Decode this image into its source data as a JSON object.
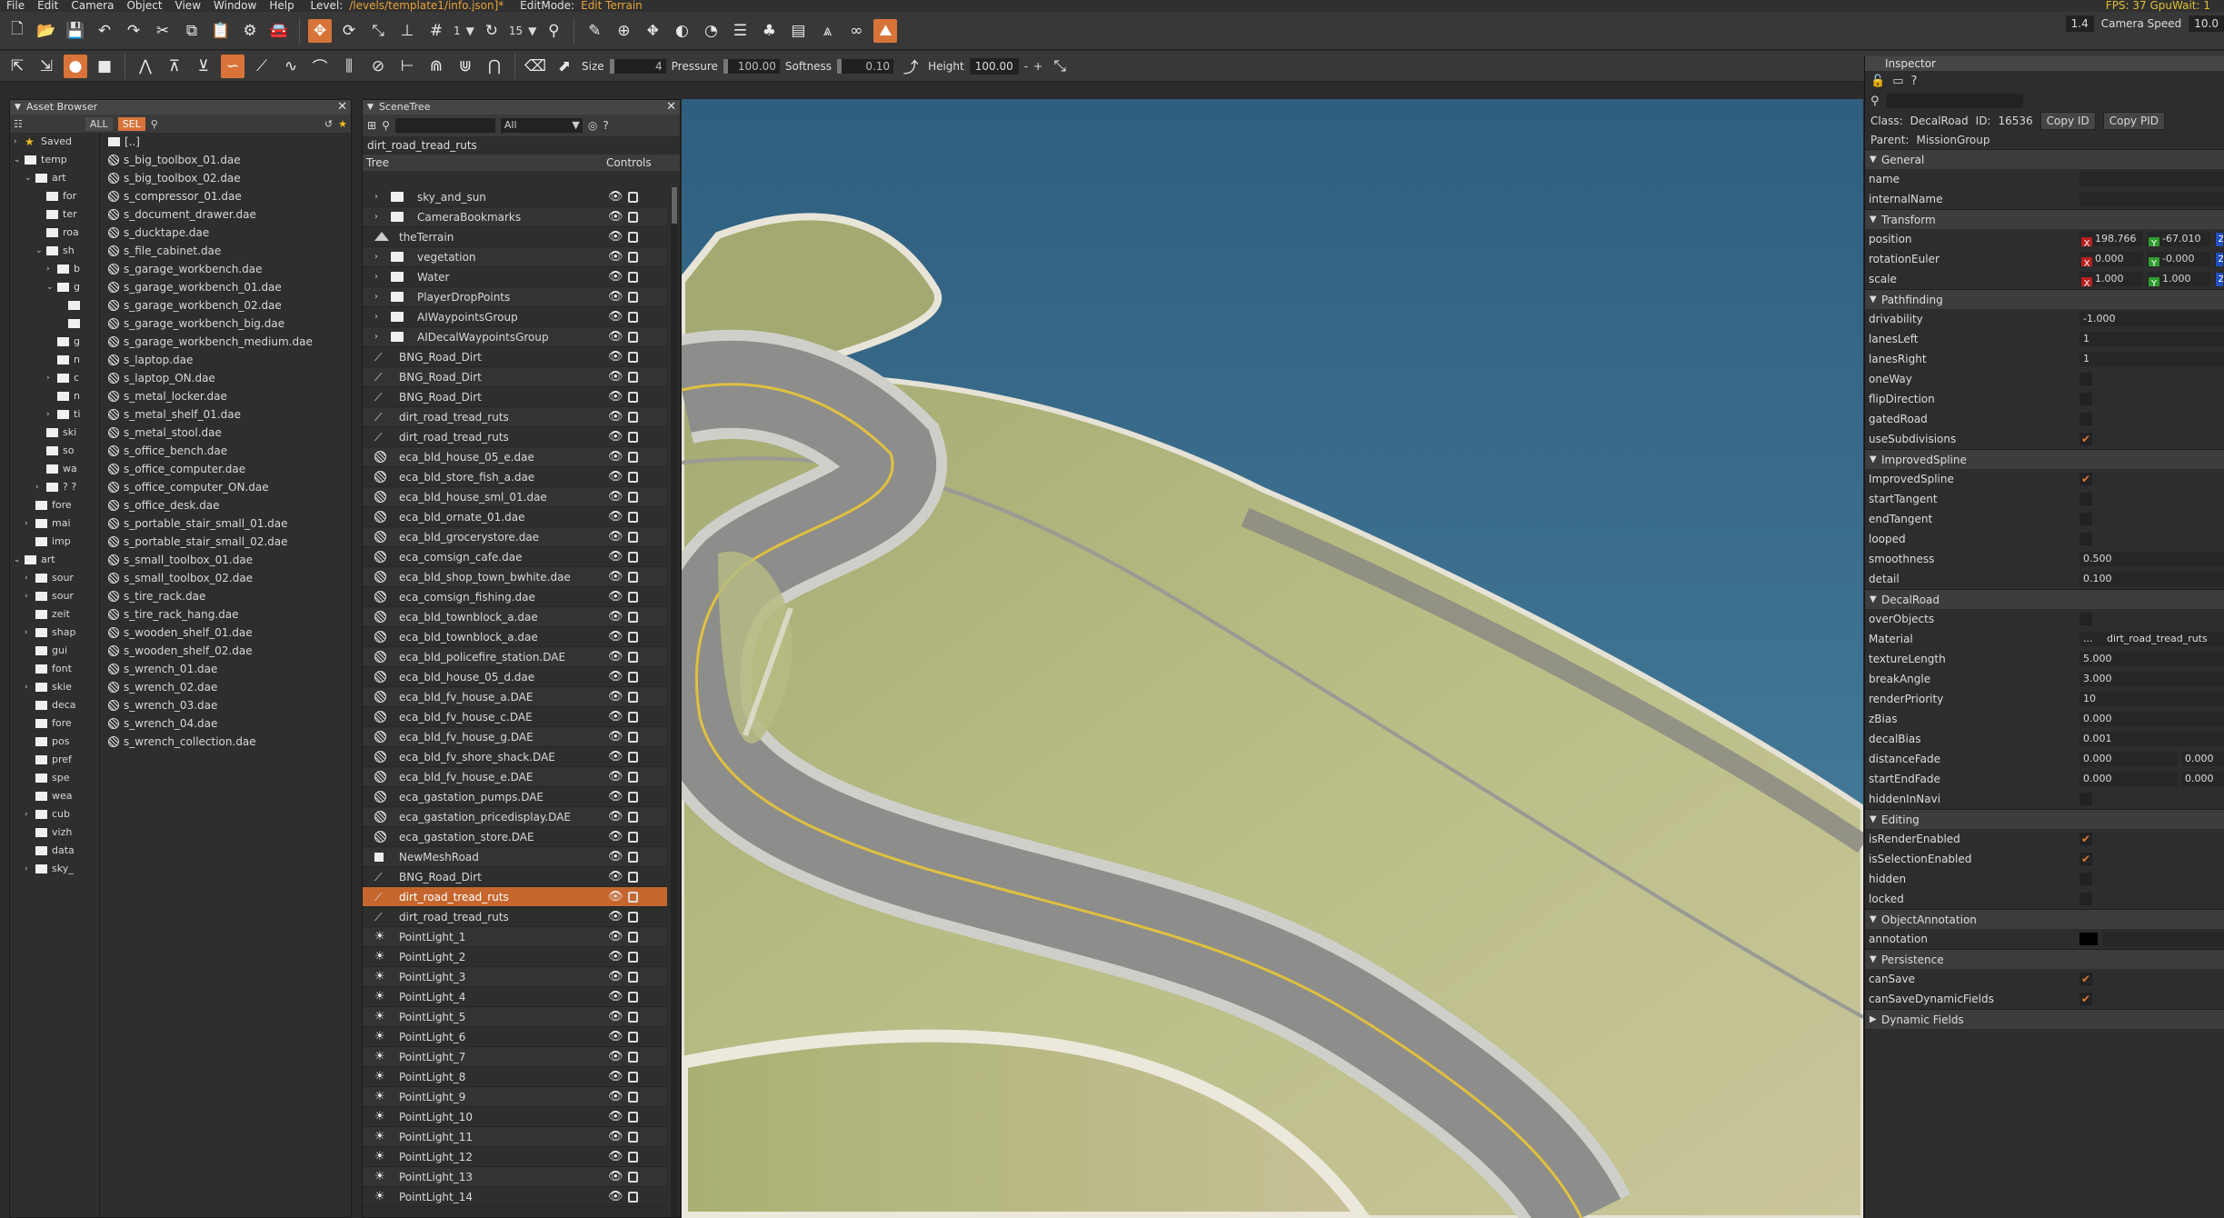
{
  "menu": {
    "items": [
      "File",
      "Edit",
      "Camera",
      "Object",
      "View",
      "Window",
      "Help"
    ],
    "level_label": "Level:",
    "level_path": "/levels/template1/info.json]*",
    "editmode_label": "EditMode:",
    "editmode_value": "Edit Terrain",
    "fps": "FPS: 37  GpuWait: 1"
  },
  "toolbar1": {
    "grid_value": "1",
    "rot_snap_value": "15",
    "right_value1": "1.4",
    "camera_speed_label": "Camera Speed",
    "camera_speed_value": "10.0"
  },
  "toolbar2": {
    "size_label": "Size",
    "size_value": "4",
    "pressure_label": "Pressure",
    "pressure_value": "100.00",
    "softness_label": "Softness",
    "softness_value": "0.10",
    "height_label": "Height",
    "height_value": "100.00",
    "minus": "-",
    "plus": "+"
  },
  "asset_browser": {
    "title": "Asset Browser",
    "all_label": "ALL",
    "sel_label": "SEL",
    "tree": [
      {
        "label": "Saved",
        "indent": 0,
        "arrow": "›",
        "star": true
      },
      {
        "label": "temp",
        "indent": 0,
        "arrow": "⌄"
      },
      {
        "label": "art",
        "indent": 1,
        "arrow": "⌄"
      },
      {
        "label": "for",
        "indent": 2,
        "arrow": ""
      },
      {
        "label": "ter",
        "indent": 2,
        "arrow": ""
      },
      {
        "label": "roa",
        "indent": 2,
        "arrow": ""
      },
      {
        "label": "sh",
        "indent": 2,
        "arrow": "⌄"
      },
      {
        "label": "b",
        "indent": 3,
        "arrow": "›"
      },
      {
        "label": "g",
        "indent": 3,
        "arrow": "⌄"
      },
      {
        "label": "",
        "indent": 4,
        "arrow": ""
      },
      {
        "label": "",
        "indent": 4,
        "arrow": ""
      },
      {
        "label": "g",
        "indent": 3,
        "arrow": ""
      },
      {
        "label": "n",
        "indent": 3,
        "arrow": ""
      },
      {
        "label": "c",
        "indent": 3,
        "arrow": "›"
      },
      {
        "label": "n",
        "indent": 3,
        "arrow": ""
      },
      {
        "label": "ti",
        "indent": 3,
        "arrow": "›"
      },
      {
        "label": "ski",
        "indent": 2,
        "arrow": ""
      },
      {
        "label": "so",
        "indent": 2,
        "arrow": ""
      },
      {
        "label": "wa",
        "indent": 2,
        "arrow": ""
      },
      {
        "label": "? ?",
        "indent": 2,
        "arrow": "›"
      },
      {
        "label": "fore",
        "indent": 1,
        "arrow": ""
      },
      {
        "label": "mai",
        "indent": 1,
        "arrow": "›"
      },
      {
        "label": "imp",
        "indent": 1,
        "arrow": ""
      },
      {
        "label": "art",
        "indent": 0,
        "arrow": "⌄"
      },
      {
        "label": "sour",
        "indent": 1,
        "arrow": "›"
      },
      {
        "label": "sour",
        "indent": 1,
        "arrow": "›"
      },
      {
        "label": "zeit",
        "indent": 1,
        "arrow": ""
      },
      {
        "label": "shap",
        "indent": 1,
        "arrow": "›"
      },
      {
        "label": "gui",
        "indent": 1,
        "arrow": ""
      },
      {
        "label": "font",
        "indent": 1,
        "arrow": ""
      },
      {
        "label": "skie",
        "indent": 1,
        "arrow": "›"
      },
      {
        "label": "deca",
        "indent": 1,
        "arrow": ""
      },
      {
        "label": "fore",
        "indent": 1,
        "arrow": ""
      },
      {
        "label": "pos",
        "indent": 1,
        "arrow": ""
      },
      {
        "label": "pref",
        "indent": 1,
        "arrow": ""
      },
      {
        "label": "spe",
        "indent": 1,
        "arrow": ""
      },
      {
        "label": "wea",
        "indent": 1,
        "arrow": ""
      },
      {
        "label": "cub",
        "indent": 1,
        "arrow": "›"
      },
      {
        "label": "vizh",
        "indent": 1,
        "arrow": ""
      },
      {
        "label": "data",
        "indent": 1,
        "arrow": ""
      },
      {
        "label": "sky_",
        "indent": 1,
        "arrow": "›"
      }
    ],
    "files": [
      "[..]",
      "s_big_toolbox_01.dae",
      "s_big_toolbox_02.dae",
      "s_compressor_01.dae",
      "s_document_drawer.dae",
      "s_ducktape.dae",
      "s_file_cabinet.dae",
      "s_garage_workbench.dae",
      "s_garage_workbench_01.dae",
      "s_garage_workbench_02.dae",
      "s_garage_workbench_big.dae",
      "s_garage_workbench_medium.dae",
      "s_laptop.dae",
      "s_laptop_ON.dae",
      "s_metal_locker.dae",
      "s_metal_shelf_01.dae",
      "s_metal_stool.dae",
      "s_office_bench.dae",
      "s_office_computer.dae",
      "s_office_computer_ON.dae",
      "s_office_desk.dae",
      "s_portable_stair_small_01.dae",
      "s_portable_stair_small_02.dae",
      "s_small_toolbox_01.dae",
      "s_small_toolbox_02.dae",
      "s_tire_rack.dae",
      "s_tire_rack_hang.dae",
      "s_wooden_shelf_01.dae",
      "s_wooden_shelf_02.dae",
      "s_wrench_01.dae",
      "s_wrench_02.dae",
      "s_wrench_03.dae",
      "s_wrench_04.dae",
      "s_wrench_collection.dae"
    ]
  },
  "scene_tree": {
    "title": "SceneTree",
    "filter_value": "All",
    "path": "dirt_road_tread_ruts",
    "col_tree": "Tree",
    "col_controls": "Controls",
    "rows": [
      {
        "label": "sky_and_sun",
        "icon": "folder",
        "expand": true
      },
      {
        "label": "CameraBookmarks",
        "icon": "folder",
        "expand": true
      },
      {
        "label": "theTerrain",
        "icon": "terrain",
        "expand": false
      },
      {
        "label": "vegetation",
        "icon": "folder",
        "expand": true
      },
      {
        "label": "Water",
        "icon": "folder",
        "expand": true
      },
      {
        "label": "PlayerDropPoints",
        "icon": "folder",
        "expand": true
      },
      {
        "label": "AIWaypointsGroup",
        "icon": "folder",
        "expand": true
      },
      {
        "label": "AIDecalWaypointsGroup",
        "icon": "folder",
        "expand": true
      },
      {
        "label": "BNG_Road_Dirt",
        "icon": "road"
      },
      {
        "label": "BNG_Road_Dirt",
        "icon": "road"
      },
      {
        "label": "BNG_Road_Dirt",
        "icon": "road"
      },
      {
        "label": "dirt_road_tread_ruts",
        "icon": "road"
      },
      {
        "label": "dirt_road_tread_ruts",
        "icon": "road"
      },
      {
        "label": "eca_bld_house_05_e.dae",
        "icon": "mesh"
      },
      {
        "label": "eca_bld_store_fish_a.dae",
        "icon": "mesh"
      },
      {
        "label": "eca_bld_house_sml_01.dae",
        "icon": "mesh"
      },
      {
        "label": "eca_bld_ornate_01.dae",
        "icon": "mesh"
      },
      {
        "label": "eca_bld_grocerystore.dae",
        "icon": "mesh"
      },
      {
        "label": "eca_comsign_cafe.dae",
        "icon": "mesh"
      },
      {
        "label": "eca_bld_shop_town_bwhite.dae",
        "icon": "mesh"
      },
      {
        "label": "eca_comsign_fishing.dae",
        "icon": "mesh"
      },
      {
        "label": "eca_bld_townblock_a.dae",
        "icon": "mesh"
      },
      {
        "label": "eca_bld_townblock_a.dae",
        "icon": "mesh"
      },
      {
        "label": "eca_bld_policefire_station.DAE",
        "icon": "mesh"
      },
      {
        "label": "eca_bld_house_05_d.dae",
        "icon": "mesh"
      },
      {
        "label": "eca_bld_fv_house_a.DAE",
        "icon": "mesh"
      },
      {
        "label": "eca_bld_fv_house_c.DAE",
        "icon": "mesh"
      },
      {
        "label": "eca_bld_fv_house_g.DAE",
        "icon": "mesh"
      },
      {
        "label": "eca_bld_fv_shore_shack.DAE",
        "icon": "mesh"
      },
      {
        "label": "eca_bld_fv_house_e.DAE",
        "icon": "mesh"
      },
      {
        "label": "eca_gastation_pumps.DAE",
        "icon": "mesh"
      },
      {
        "label": "eca_gastation_pricedisplay.DAE",
        "icon": "mesh"
      },
      {
        "label": "eca_gastation_store.DAE",
        "icon": "mesh"
      },
      {
        "label": "NewMeshRoad",
        "icon": "box"
      },
      {
        "label": "BNG_Road_Dirt",
        "icon": "road"
      },
      {
        "label": "dirt_road_tread_ruts",
        "icon": "road",
        "selected": true
      },
      {
        "label": "dirt_road_tread_ruts",
        "icon": "road"
      },
      {
        "label": "PointLight_1",
        "icon": "light"
      },
      {
        "label": "PointLight_2",
        "icon": "light"
      },
      {
        "label": "PointLight_3",
        "icon": "light"
      },
      {
        "label": "PointLight_4",
        "icon": "light"
      },
      {
        "label": "PointLight_5",
        "icon": "light"
      },
      {
        "label": "PointLight_6",
        "icon": "light"
      },
      {
        "label": "PointLight_7",
        "icon": "light"
      },
      {
        "label": "PointLight_8",
        "icon": "light"
      },
      {
        "label": "PointLight_9",
        "icon": "light"
      },
      {
        "label": "PointLight_10",
        "icon": "light"
      },
      {
        "label": "PointLight_11",
        "icon": "light"
      },
      {
        "label": "PointLight_12",
        "icon": "light"
      },
      {
        "label": "PointLight_13",
        "icon": "light"
      },
      {
        "label": "PointLight_14",
        "icon": "light"
      }
    ]
  },
  "inspector": {
    "title": "Inspector",
    "class_label": "Class:",
    "class_value": "DecalRoad",
    "id_label": "ID:",
    "id_value": "16536",
    "copy_id": "Copy ID",
    "copy_pid": "Copy PID",
    "parent_label": "Parent:",
    "parent_value": "MissionGroup",
    "rows": [
      {
        "type": "section",
        "label": "General"
      },
      {
        "type": "text",
        "label": "name",
        "value": ""
      },
      {
        "type": "text",
        "label": "internalName",
        "value": ""
      },
      {
        "type": "section",
        "label": "Transform"
      },
      {
        "type": "vec",
        "label": "position",
        "x": "198.766",
        "y": "-67.010"
      },
      {
        "type": "vec",
        "label": "rotationEuler",
        "x": "0.000",
        "y": "-0.000"
      },
      {
        "type": "vec",
        "label": "scale",
        "x": "1.000",
        "y": "1.000"
      },
      {
        "type": "section",
        "label": "Pathfinding"
      },
      {
        "type": "text",
        "label": "drivability",
        "value": "-1.000"
      },
      {
        "type": "text",
        "label": "lanesLeft",
        "value": "1"
      },
      {
        "type": "text",
        "label": "lanesRight",
        "value": "1"
      },
      {
        "type": "check",
        "label": "oneWay",
        "checked": false
      },
      {
        "type": "check",
        "label": "flipDirection",
        "checked": false
      },
      {
        "type": "check",
        "label": "gatedRoad",
        "checked": false
      },
      {
        "type": "check",
        "label": "useSubdivisions",
        "checked": true
      },
      {
        "type": "section",
        "label": "ImprovedSpline"
      },
      {
        "type": "check",
        "label": "ImprovedSpline",
        "checked": true
      },
      {
        "type": "check",
        "label": "startTangent",
        "checked": false
      },
      {
        "type": "check",
        "label": "endTangent",
        "checked": false
      },
      {
        "type": "check",
        "label": "looped",
        "checked": false
      },
      {
        "type": "text",
        "label": "smoothness",
        "value": "0.500"
      },
      {
        "type": "text",
        "label": "detail",
        "value": "0.100"
      },
      {
        "type": "section",
        "label": "DecalRoad"
      },
      {
        "type": "check",
        "label": "overObjects",
        "checked": false
      },
      {
        "type": "material",
        "label": "Material",
        "value": "dirt_road_tread_ruts",
        "btn": "..."
      },
      {
        "type": "text",
        "label": "textureLength",
        "value": "5.000"
      },
      {
        "type": "text",
        "label": "breakAngle",
        "value": "3.000"
      },
      {
        "type": "text",
        "label": "renderPriority",
        "value": "10"
      },
      {
        "type": "text",
        "label": "zBias",
        "value": "0.000"
      },
      {
        "type": "text",
        "label": "decalBias",
        "value": "0.001"
      },
      {
        "type": "pair",
        "label": "distanceFade",
        "a": "0.000",
        "b": "0.000"
      },
      {
        "type": "pair",
        "label": "startEndFade",
        "a": "0.000",
        "b": "0.000"
      },
      {
        "type": "check",
        "label": "hiddenInNavi",
        "checked": false
      },
      {
        "type": "section",
        "label": "Editing"
      },
      {
        "type": "check",
        "label": "isRenderEnabled",
        "checked": true
      },
      {
        "type": "check",
        "label": "isSelectionEnabled",
        "checked": true
      },
      {
        "type": "check",
        "label": "hidden",
        "checked": false
      },
      {
        "type": "check",
        "label": "locked",
        "checked": false
      },
      {
        "type": "section",
        "label": "ObjectAnnotation"
      },
      {
        "type": "color",
        "label": "annotation"
      },
      {
        "type": "section",
        "label": "Persistence"
      },
      {
        "type": "check",
        "label": "canSave",
        "checked": true
      },
      {
        "type": "check",
        "label": "canSaveDynamicFields",
        "checked": true
      },
      {
        "type": "section",
        "label": "Dynamic Fields",
        "collapsed": true
      }
    ]
  },
  "colors": {
    "accent": "#d8743a",
    "selected_row": "#c5662e",
    "panel_bg": "#2e2e2e",
    "toolbar_bg": "#383838"
  }
}
